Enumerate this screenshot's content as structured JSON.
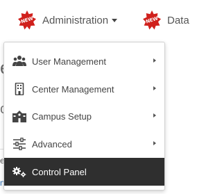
{
  "nav": {
    "badge_text": "NEW",
    "admin_label": "Administration",
    "data_label": "Data"
  },
  "background": {
    "frag_e": "e",
    "frag_c": "c",
    "frag_t": "e",
    "frag_m": "n"
  },
  "menu": {
    "items": [
      {
        "label": "User Management",
        "icon": "users-icon",
        "has_submenu": true
      },
      {
        "label": "Center Management",
        "icon": "building-icon",
        "has_submenu": true
      },
      {
        "label": "Campus Setup",
        "icon": "campus-icon",
        "has_submenu": true
      },
      {
        "label": "Advanced",
        "icon": "sliders-icon",
        "has_submenu": true
      },
      {
        "label": "Control Panel",
        "icon": "gears-icon",
        "has_submenu": false,
        "active": true
      }
    ]
  },
  "colors": {
    "badge_red": "#d0201c",
    "active_bg": "#2f2f2f",
    "text": "#444444"
  }
}
